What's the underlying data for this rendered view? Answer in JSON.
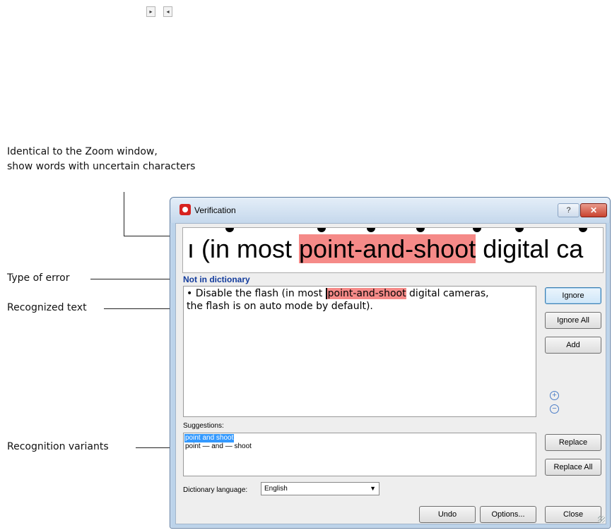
{
  "top_arrows": {
    "right": "▸",
    "left": "◂"
  },
  "callouts": {
    "zoom_line1": "Identical to the Zoom window,",
    "zoom_line2": "show words with uncertain characters",
    "error_type": "Type of error",
    "recognized_text": "Recognized text",
    "variants": "Recognition variants"
  },
  "window": {
    "title": "Verification",
    "help_label": "?",
    "close_label": "✕",
    "zoom": {
      "prefix": "ı (in most ",
      "highlight": "point-and-shoot",
      "suffix": " digital ca"
    },
    "error_type": "Not in dictionary",
    "text": {
      "bullet": "•   Disable the flash (in most ",
      "highlight": "point-and-shoot",
      "after": " digital cameras,",
      "line2": "the flash is on auto mode by default)."
    },
    "buttons": {
      "ignore": "Ignore",
      "ignore_all": "Ignore All",
      "add": "Add",
      "replace": "Replace",
      "replace_all": "Replace All"
    },
    "zoom_controls": {
      "in": "+",
      "out": "−"
    },
    "suggestions": {
      "label": "Suggestions:",
      "items": [
        "point and shoot",
        "point — and — shoot"
      ]
    },
    "dictionary": {
      "label": "Dictionary language:",
      "value": "English",
      "arrow": "▼"
    },
    "bottom_buttons": {
      "undo": "Undo",
      "options": "Options...",
      "close": "Close"
    }
  },
  "colors": {
    "highlight": "#f58a88",
    "error_type": "#123b9c",
    "selection": "#3399ff"
  }
}
